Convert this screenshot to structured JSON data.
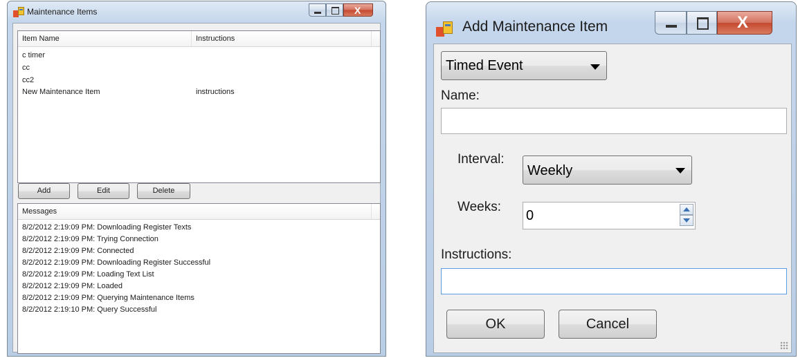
{
  "maintenance_window": {
    "title": "Maintenance Items",
    "columns": [
      "Item Name",
      "Instructions"
    ],
    "items": [
      {
        "name": "c timer",
        "instructions": ""
      },
      {
        "name": "cc",
        "instructions": ""
      },
      {
        "name": "cc2",
        "instructions": ""
      },
      {
        "name": "New Maintenance Item",
        "instructions": "instructions"
      }
    ],
    "buttons": {
      "add": "Add",
      "edit": "Edit",
      "delete": "Delete"
    },
    "messages_header": "Messages",
    "messages": [
      "8/2/2012 2:19:09 PM: Downloading Register Texts",
      "8/2/2012 2:19:09 PM: Trying Connection",
      "8/2/2012 2:19:09 PM: Connected",
      "8/2/2012 2:19:09 PM: Downloading Register Successful",
      "8/2/2012 2:19:09 PM: Loading Text List",
      "8/2/2012 2:19:09 PM: Loaded",
      "8/2/2012 2:19:09 PM: Querying Maintenance Items",
      "8/2/2012 2:19:10 PM: Query Successful"
    ]
  },
  "add_dialog": {
    "title": "Add Maintenance Item",
    "event_type": "Timed Event",
    "name_label": "Name:",
    "name_value": "",
    "interval_label": "Interval:",
    "interval_value": "Weekly",
    "weeks_label": "Weeks:",
    "weeks_value": "0",
    "instructions_label": "Instructions:",
    "instructions_value": "",
    "ok": "OK",
    "cancel": "Cancel"
  },
  "icons": {
    "app": "app-window-icon",
    "minimize": "minimize-icon",
    "maximize": "maximize-icon",
    "close": "close-icon"
  },
  "colors": {
    "title_bar": "#c4d6eb",
    "close_button": "#c4482f",
    "focus_border": "#569de5"
  }
}
